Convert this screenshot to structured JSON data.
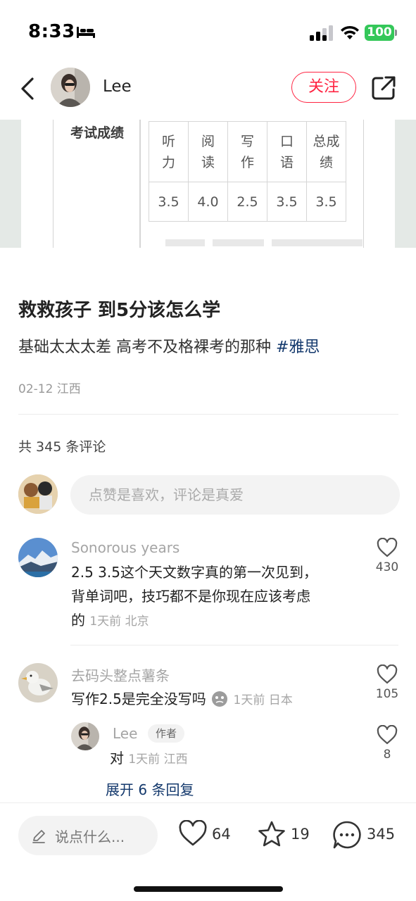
{
  "status_bar": {
    "time": "8:33",
    "battery": "100"
  },
  "header": {
    "author_name": "Lee",
    "follow_label": "关注"
  },
  "note_image": {
    "score_label": "考试成绩",
    "table_headers": [
      "听\n力",
      "阅\n读",
      "写\n作",
      "口\n语",
      "总成\n绩"
    ],
    "table_values": [
      "3.5",
      "4.0",
      "2.5",
      "3.5",
      "3.5"
    ]
  },
  "note": {
    "title": "救救孩子 到5分该怎么学",
    "desc": "基础太太太差 高考不及格裸考的那种 ",
    "hashtag": "#雅思",
    "meta": "02-12 江西"
  },
  "comments": {
    "count_label": "共 345 条评论",
    "input_placeholder": "点赞是喜欢，评论是真爱",
    "items": [
      {
        "name": "Sonorous years",
        "text_line1": "2.5 3.5这个天文数字真的第一次见到，",
        "text_line2": "背单词吧，技巧都不是你现在应该考虑",
        "text_line3": "的",
        "time": "1天前 北京",
        "likes": "430"
      },
      {
        "name": "去码头整点薯条",
        "text": "写作2.5是完全没写吗",
        "time": "1天前 日本",
        "likes": "105"
      },
      {
        "name": "Lee",
        "badge": "作者",
        "text": "对",
        "time": "1天前 江西",
        "likes": "8"
      }
    ],
    "expand_label": "展开 6 条回复"
  },
  "bottom_bar": {
    "input_placeholder": "说点什么...",
    "likes": "64",
    "collects": "19",
    "comments": "345"
  }
}
